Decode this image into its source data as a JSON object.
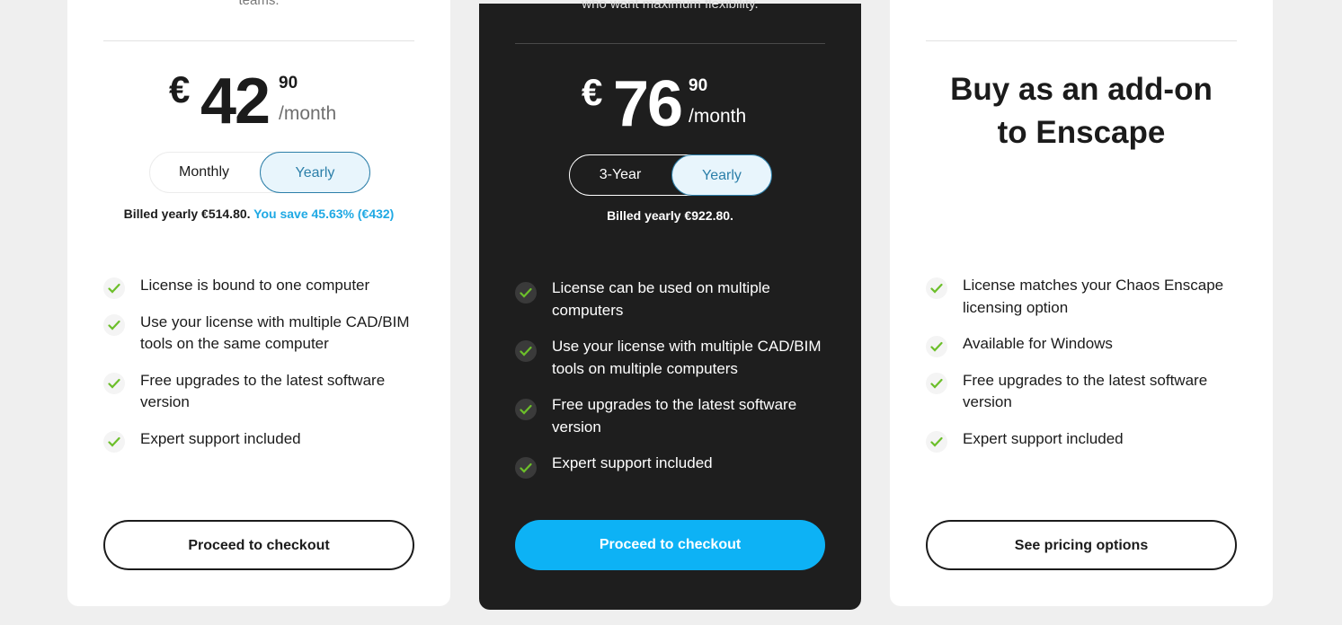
{
  "plans": [
    {
      "top_text": "teams.",
      "currency": "€",
      "price_int": "42",
      "price_cents": "90",
      "per": "/month",
      "toggle": [
        "Monthly",
        "Yearly"
      ],
      "billed": "Billed yearly €514.80.",
      "save": "You save 45.63% (€432)",
      "features": [
        "License is bound to one computer",
        "Use your license with multiple CAD/BIM tools on the same computer",
        "Free upgrades to the latest software version",
        "Expert support included"
      ],
      "cta": "Proceed to checkout"
    },
    {
      "top_text": "who want maximum flexibility.",
      "currency": "€",
      "price_int": "76",
      "price_cents": "90",
      "per": "/month",
      "toggle": [
        "3-Year",
        "Yearly"
      ],
      "billed": "Billed yearly €922.80.",
      "features": [
        "License can be used on multiple computers",
        "Use your license with multiple CAD/BIM tools on multiple computers",
        "Free upgrades to the latest software version",
        "Expert support included"
      ],
      "cta": "Proceed to checkout"
    },
    {
      "addon_title_line1": "Buy as an add-on",
      "addon_title_line2": "to Enscape",
      "features": [
        "License matches your Chaos Enscape licensing option",
        "Available for Windows",
        "Free upgrades to the latest software version",
        "Expert support included"
      ],
      "cta": "See pricing options"
    }
  ],
  "colors": {
    "accent": "#0db2f5",
    "save_text": "#1fa9e4",
    "dark_card": "#1e1e1e",
    "check": "#6cbf2a"
  },
  "icons": {
    "feature": "check-icon"
  }
}
